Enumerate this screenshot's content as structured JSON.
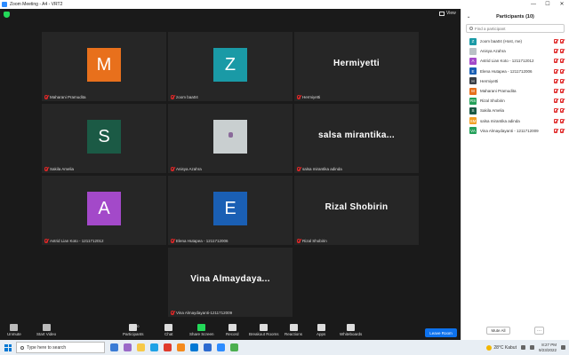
{
  "window": {
    "title": "Zoom Meeting - A4 - VRT2",
    "min": "—",
    "max": "☐",
    "close": "✕"
  },
  "meeting": {
    "view_label": "View",
    "tiles": [
      {
        "type": "avatar",
        "letter": "M",
        "color": "#e8701c",
        "label": "Maharani Pramudita"
      },
      {
        "type": "avatar",
        "letter": "Z",
        "color": "#1a9aa6",
        "label": "zoom baa04"
      },
      {
        "type": "name",
        "name": "Hermiyetti",
        "label": "Hermiyetti"
      },
      {
        "type": "avatar",
        "letter": "S",
        "color": "#1b5a45",
        "label": "Sakila Amelia"
      },
      {
        "type": "photo",
        "label": "Anisya Azahra"
      },
      {
        "type": "name",
        "name": "salsa mirantika...",
        "label": "salsa mirantika adinda"
      },
      {
        "type": "avatar",
        "letter": "A",
        "color": "#a349c9",
        "label": "Astrid Lian Koto - 1211712012"
      },
      {
        "type": "avatar",
        "letter": "E",
        "color": "#1a5fb4",
        "label": "Elena Hutapea - 1211712006"
      },
      {
        "type": "name",
        "name": "Rizal Shobirin",
        "label": "Rizal Shobirin"
      },
      {
        "type": "name",
        "name": "Vina Almaydaya...",
        "label": "Vina Almaydayanti-1211712009"
      }
    ]
  },
  "toolbar": {
    "items": [
      {
        "name": "unmute",
        "label": "Unmute",
        "color": "#bbbbbb"
      },
      {
        "name": "start-video",
        "label": "Start Video",
        "color": "#bbbbbb"
      },
      {
        "name": "participants",
        "label": "Participants",
        "badge": "10",
        "color": "#dddddd"
      },
      {
        "name": "chat",
        "label": "Chat",
        "color": "#dddddd"
      },
      {
        "name": "share-screen",
        "label": "Share Screen",
        "color": "#23d959"
      },
      {
        "name": "record",
        "label": "Record",
        "color": "#dddddd"
      },
      {
        "name": "breakout-rooms",
        "label": "Breakout Rooms",
        "color": "#dddddd"
      },
      {
        "name": "reactions",
        "label": "Reactions",
        "color": "#dddddd"
      },
      {
        "name": "apps",
        "label": "Apps",
        "color": "#dddddd"
      },
      {
        "name": "whiteboards",
        "label": "Whiteboards",
        "color": "#dddddd"
      }
    ],
    "leave_label": "Leave Room"
  },
  "panel": {
    "title": "Participants (10)",
    "search_placeholder": "Find a participant",
    "participants": [
      {
        "initials": "Z",
        "color": "#1a9aa6",
        "name": "zoom baa04 (Host, me)"
      },
      {
        "initials": "",
        "color": "#b9c1c6",
        "name": "Anisya Azahra"
      },
      {
        "initials": "A",
        "color": "#a349c9",
        "name": "Astrid Lian Koto - 1211712012"
      },
      {
        "initials": "E",
        "color": "#1a5fb4",
        "name": "Elena Hutapea - 1211712006"
      },
      {
        "initials": "H",
        "color": "#3a3f46",
        "name": "Hermiyetti"
      },
      {
        "initials": "M",
        "color": "#e8701c",
        "name": "Maharani Pramudita"
      },
      {
        "initials": "RS",
        "color": "#23a059",
        "name": "Rizal Shobirin"
      },
      {
        "initials": "S",
        "color": "#1b5a45",
        "name": "Sakila Amelia"
      },
      {
        "initials": "SM",
        "color": "#f2a024",
        "name": "salsa mirantika adinda"
      },
      {
        "initials": "VA",
        "color": "#23a059",
        "name": "Vina Almaydayanti - 1211712009"
      }
    ],
    "mute_all": "Mute All",
    "more": "···"
  },
  "taskbar": {
    "search_placeholder": "Type here to search",
    "weather": "28°C Kabut",
    "time": "8:27 PM",
    "date": "9/23/2022"
  }
}
